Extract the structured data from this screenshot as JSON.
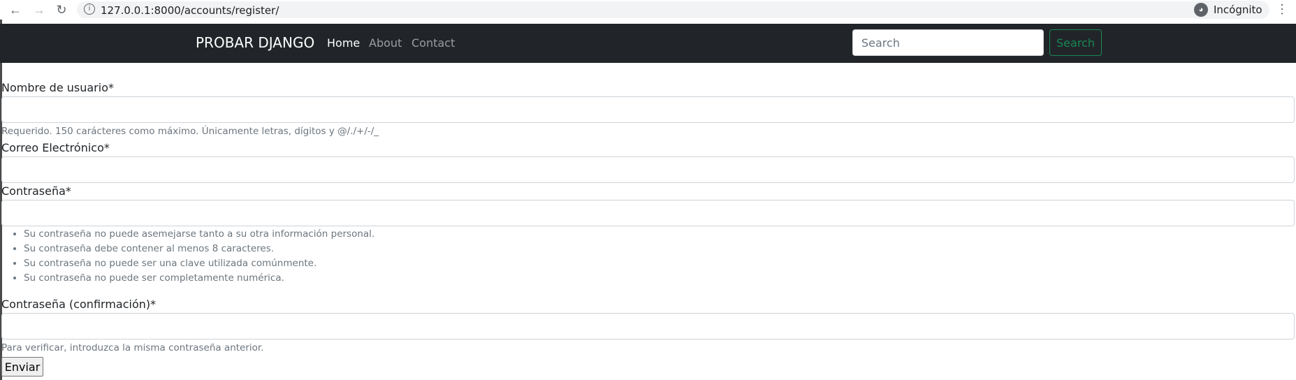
{
  "browser": {
    "url": "127.0.0.1:8000/accounts/register/",
    "incognito_label": "Incógnito",
    "icons": [
      "back-arrow-icon",
      "forward-arrow-icon",
      "reload-icon",
      "info-icon",
      "star-icon",
      "incognito-icon",
      "kebab-menu-icon"
    ]
  },
  "navbar": {
    "brand": "PROBAR DJANGO",
    "links": [
      "Home",
      "About",
      "Contact"
    ],
    "active": "Home",
    "search_placeholder": "Search",
    "search_button": "Search",
    "colors": {
      "background": "#212529",
      "search_button": "#198754"
    }
  },
  "form": {
    "username": {
      "label": "Nombre de usuario*",
      "help": "Requerido. 150 carácteres como máximo. Únicamente letras, dígitos y @/./+/-/_"
    },
    "email": {
      "label": "Correo Electrónico*"
    },
    "password1": {
      "label": "Contraseña*",
      "rules": [
        "Su contraseña no puede asemejarse tanto a su otra información personal.",
        "Su contraseña debe contener al menos 8 caracteres.",
        "Su contraseña no puede ser una clave utilizada comúnmente.",
        "Su contraseña no puede ser completamente numérica."
      ]
    },
    "password2": {
      "label": "Contraseña (confirmación)*",
      "help": "Para verificar, introduzca la misma contraseña anterior."
    },
    "submit": "Enviar"
  }
}
